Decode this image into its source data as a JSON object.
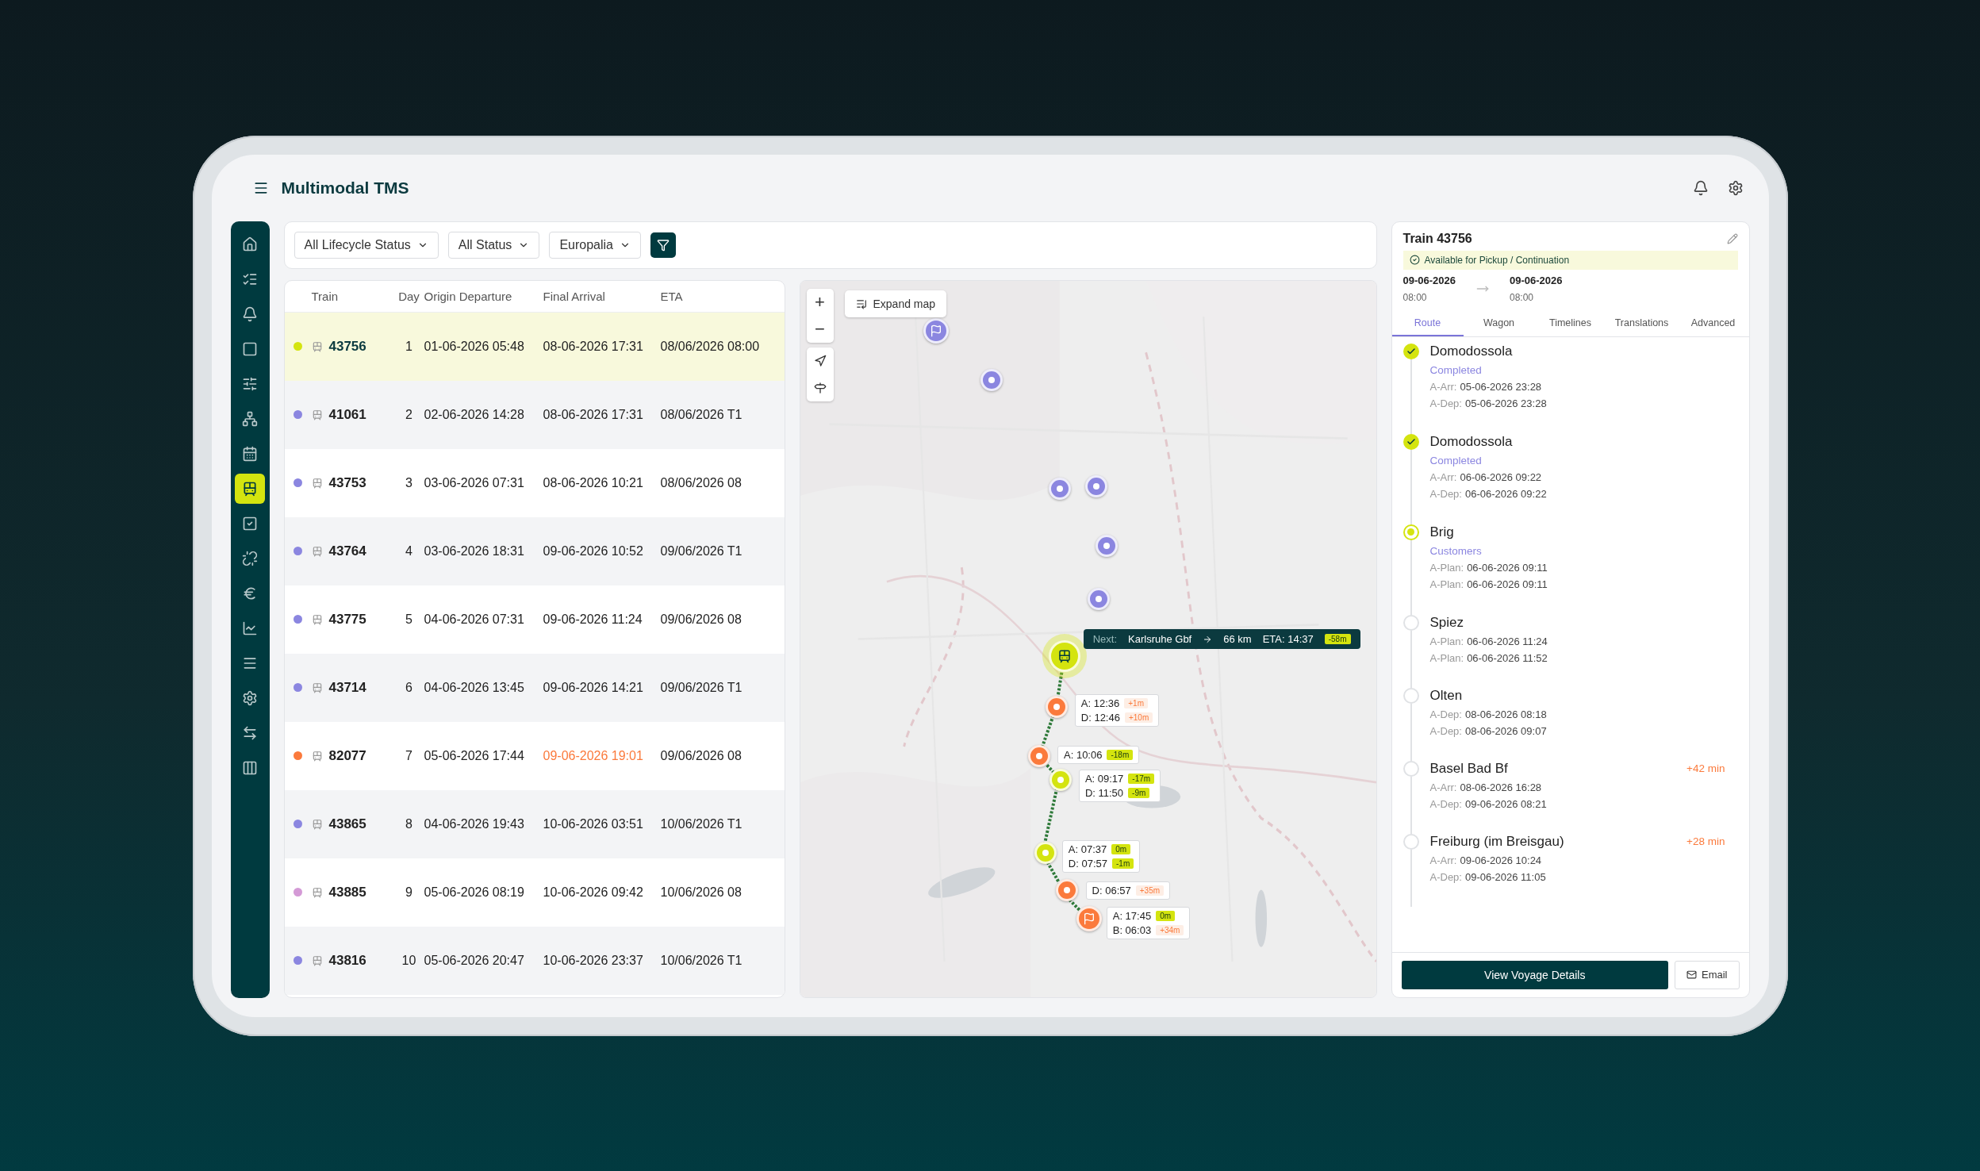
{
  "app": {
    "title": "Multimodal TMS"
  },
  "sidebar": {
    "items": [
      {
        "selected": false
      },
      {
        "selected": false
      },
      {
        "selected": false
      },
      {
        "selected": false
      },
      {
        "selected": false
      },
      {
        "selected": false
      },
      {
        "selected": false
      },
      {
        "selected": true
      },
      {
        "selected": false
      },
      {
        "selected": false
      },
      {
        "selected": false
      },
      {
        "selected": false
      },
      {
        "selected": false
      },
      {
        "selected": false
      },
      {
        "selected": false
      },
      {
        "selected": false
      }
    ]
  },
  "filters": [
    {
      "label": "All Lifecycle Status"
    },
    {
      "label": "All Status"
    },
    {
      "label": "Europalia"
    }
  ],
  "table": {
    "columns": [
      "Train",
      "Day",
      "Origin Departure",
      "Final Arrival",
      "ETA"
    ],
    "rows": [
      {
        "color": "#d4e40f",
        "train": "43756",
        "day": "1",
        "origin_departure": "01-06-2026 05:48",
        "final_arrival": "08-06-2026 17:31",
        "late": false,
        "eta": "08/06/2026 08:00",
        "selected": true
      },
      {
        "color": "#8b86e0",
        "train": "41061",
        "day": "2",
        "origin_departure": "02-06-2026 14:28",
        "final_arrival": "08-06-2026 17:31",
        "late": false,
        "eta": "08/06/2026 T1",
        "selected": false
      },
      {
        "color": "#8b86e0",
        "train": "43753",
        "day": "3",
        "origin_departure": "03-06-2026 07:31",
        "final_arrival": "08-06-2026 10:21",
        "late": false,
        "eta": "08/06/2026 08",
        "selected": false
      },
      {
        "color": "#8b86e0",
        "train": "43764",
        "day": "4",
        "origin_departure": "03-06-2026 18:31",
        "final_arrival": "09-06-2026 10:52",
        "late": false,
        "eta": "09/06/2026 T1",
        "selected": false
      },
      {
        "color": "#8b86e0",
        "train": "43775",
        "day": "5",
        "origin_departure": "04-06-2026 07:31",
        "final_arrival": "09-06-2026 11:24",
        "late": false,
        "eta": "09/06/2026 08",
        "selected": false
      },
      {
        "color": "#8b86e0",
        "train": "43714",
        "day": "6",
        "origin_departure": "04-06-2026 13:45",
        "final_arrival": "09-06-2026 14:21",
        "late": false,
        "eta": "09/06/2026 T1",
        "selected": false
      },
      {
        "color": "#fb7a3c",
        "train": "82077",
        "day": "7",
        "origin_departure": "05-06-2026 17:44",
        "final_arrival": "09-06-2026 19:01",
        "late": true,
        "eta": "09/06/2026 08",
        "selected": false
      },
      {
        "color": "#8b86e0",
        "train": "43865",
        "day": "8",
        "origin_departure": "04-06-2026 19:43",
        "final_arrival": "10-06-2026 03:51",
        "late": false,
        "eta": "10/06/2026 T1",
        "selected": false
      },
      {
        "color": "#d49ad6",
        "train": "43885",
        "day": "9",
        "origin_departure": "05-06-2026 08:19",
        "final_arrival": "10-06-2026 09:42",
        "late": false,
        "eta": "10/06/2026 08",
        "selected": false
      },
      {
        "color": "#8b86e0",
        "train": "43816",
        "day": "10",
        "origin_departure": "05-06-2026 20:47",
        "final_arrival": "10-06-2026 23:37",
        "late": false,
        "eta": "10/06/2026 T1",
        "selected": false
      }
    ]
  },
  "map": {
    "expand_button": "Expand map",
    "controls": [
      "+",
      "−"
    ],
    "markers": [
      {
        "kind": "flag",
        "color": "#8b86e0"
      },
      {
        "kind": "stop",
        "color": "#8b86e0"
      },
      {
        "kind": "stop",
        "color": "#8b86e0"
      },
      {
        "kind": "stop",
        "color": "#8b86e0"
      },
      {
        "kind": "stop",
        "color": "#8b86e0"
      },
      {
        "kind": "stop",
        "color": "#8b86e0"
      },
      {
        "kind": "train",
        "color": "#d4e40f"
      },
      {
        "kind": "stop",
        "color": "#fb7a3c"
      },
      {
        "kind": "stop",
        "color": "#fb7a3c"
      },
      {
        "kind": "stop",
        "color": "#d4e40f"
      },
      {
        "kind": "stop",
        "color": "#d4e40f"
      },
      {
        "kind": "stop",
        "color": "#fb7a3c"
      },
      {
        "kind": "flag",
        "color": "#fb7a3c"
      }
    ],
    "next": {
      "label": "Next:",
      "station": "Karlsruhe Gbf",
      "distance": "66 km",
      "eta": "ETA: 14:37",
      "delta": "-58m"
    },
    "callouts": [
      {
        "lines": [
          {
            "time": "A: 12:36",
            "delta": "+1m",
            "late": true
          },
          {
            "time": "D: 12:46",
            "delta": "+10m",
            "late": true
          }
        ]
      },
      {
        "lines": [
          {
            "time": "A: 10:06",
            "delta": "-18m",
            "late": false
          }
        ]
      },
      {
        "lines": [
          {
            "time": "A: 09:17",
            "delta": "-17m",
            "late": false
          },
          {
            "time": "D: 11:50",
            "delta": "-9m",
            "late": false
          }
        ]
      },
      {
        "lines": [
          {
            "time": "A: 07:37",
            "delta": "0m",
            "late": false
          },
          {
            "time": "D: 07:57",
            "delta": "-1m",
            "late": false
          }
        ]
      },
      {
        "lines": [
          {
            "time": "D: 06:57",
            "delta": "+35m",
            "late": true
          }
        ]
      },
      {
        "lines": [
          {
            "time": "A: 17:45",
            "delta": "0m",
            "late": false
          },
          {
            "time": "B: 06:03",
            "delta": "+34m",
            "late": true
          }
        ]
      }
    ]
  },
  "detail": {
    "title": "Train 43756",
    "status": "Available for Pickup / Continuation",
    "from": {
      "date": "09-06-2026",
      "time": "08:00"
    },
    "to": {
      "date": "09-06-2026",
      "time": "08:00"
    },
    "tabs": [
      {
        "label": "Route",
        "selected": true
      },
      {
        "label": "Wagon",
        "selected": false
      },
      {
        "label": "Timelines",
        "selected": false
      },
      {
        "label": "Translations",
        "selected": false
      },
      {
        "label": "Advanced",
        "selected": false
      }
    ],
    "stops": [
      {
        "name": "Domodossola",
        "completed": true,
        "current": false,
        "tag": "Completed",
        "lines": [
          {
            "label": "A-Arr:",
            "value": "05-06-2026 23:28"
          },
          {
            "label": "A-Dep:",
            "value": "05-06-2026 23:28"
          }
        ]
      },
      {
        "name": "Domodossola",
        "completed": true,
        "current": false,
        "tag": "Completed",
        "lines": [
          {
            "label": "A-Arr:",
            "value": "06-06-2026 09:22"
          },
          {
            "label": "A-Dep:",
            "value": "06-06-2026 09:22"
          }
        ]
      },
      {
        "name": "Brig",
        "completed": false,
        "current": true,
        "tag": "Customers",
        "lines": [
          {
            "label": "A-Plan:",
            "value": "06-06-2026 09:11"
          },
          {
            "label": "A-Plan:",
            "value": "06-06-2026 09:11"
          }
        ]
      },
      {
        "name": "Spiez",
        "completed": false,
        "current": false,
        "lines": [
          {
            "label": "A-Plan:",
            "value": "06-06-2026 11:24"
          },
          {
            "label": "A-Plan:",
            "value": "06-06-2026 11:52"
          }
        ]
      },
      {
        "name": "Olten",
        "completed": false,
        "current": false,
        "lines": [
          {
            "label": "A-Dep:",
            "value": "08-06-2026 08:18"
          },
          {
            "label": "A-Dep:",
            "value": "08-06-2026 09:07"
          }
        ]
      },
      {
        "name": "Basel Bad Bf",
        "completed": false,
        "current": false,
        "delay": "+42 min",
        "lines": [
          {
            "label": "A-Arr:",
            "value": "08-06-2026 16:28"
          },
          {
            "label": "A-Dep:",
            "value": "09-06-2026 08:21"
          }
        ]
      },
      {
        "name": "Freiburg (im Breisgau)",
        "completed": false,
        "current": false,
        "delay": "+28 min",
        "lines": [
          {
            "label": "A-Arr:",
            "value": "09-06-2026 10:24"
          },
          {
            "label": "A-Dep:",
            "value": "09-06-2026 11:05"
          }
        ]
      }
    ],
    "primary_button": "View Voyage Details",
    "email_button": "Email"
  }
}
